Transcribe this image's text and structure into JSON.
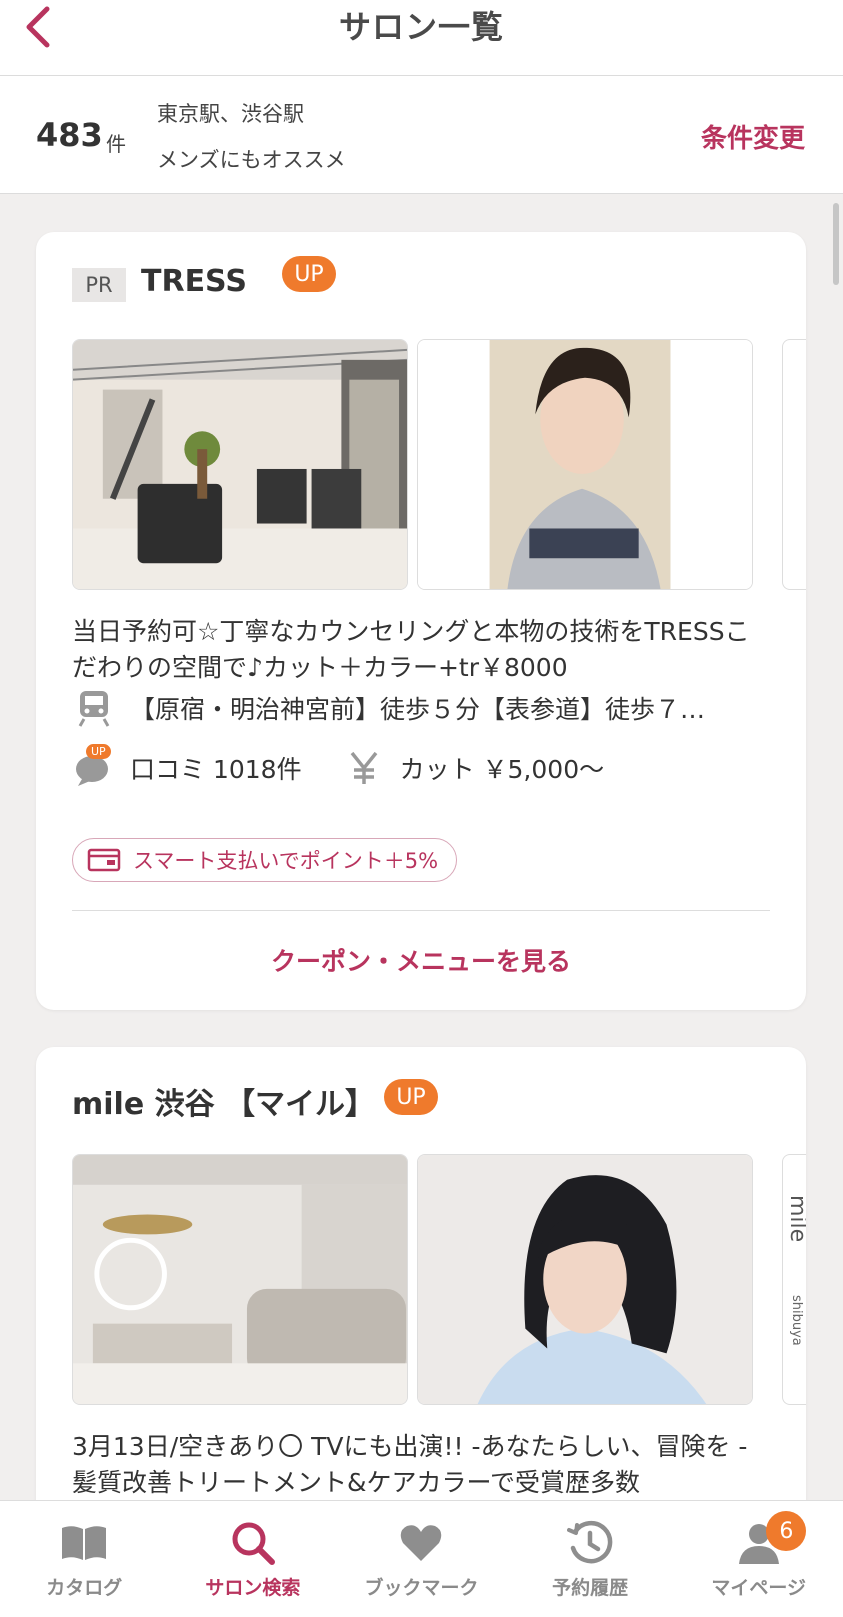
{
  "header": {
    "title": "サロン一覧"
  },
  "summary": {
    "count": "483",
    "count_unit": "件",
    "conditions": [
      "東京駅、渋谷駅",
      "メンズにもオススメ"
    ],
    "change_label": "条件変更"
  },
  "salons": [
    {
      "pr_label": "PR",
      "name": "TRESS",
      "badge": "UP",
      "description": "当日予約可☆丁寧なカウンセリングと本物の技術をTRESSこだわりの空間で♪カット＋カラー+tr￥8000",
      "access": "【原宿・明治神宮前】徒歩５分【表参道】徒歩７…",
      "review_badge": "UP",
      "reviews": "口コミ 1018件",
      "price": "カット ￥5,000〜",
      "payment": "スマート支払いでポイント＋5%",
      "coupon_label": "クーポン・メニューを見る"
    },
    {
      "name": "mile 渋谷 【マイル】",
      "badge": "UP",
      "peek_text": "mile",
      "peek_sub": "shibuya",
      "description": "3月13日/空きあり〇 TVにも出演!! -あなたらしい、冒険を -髪質改善トリートメント&ケアカラーで受賞歴多数"
    }
  ],
  "tabs": [
    {
      "label": "カタログ",
      "icon": "book-icon"
    },
    {
      "label": "サロン検索",
      "icon": "search-icon",
      "active": true
    },
    {
      "label": "ブックマーク",
      "icon": "heart-icon"
    },
    {
      "label": "予約履歴",
      "icon": "history-icon"
    },
    {
      "label": "マイページ",
      "icon": "person-icon",
      "badge": "6"
    }
  ],
  "colors": {
    "accent": "#b8345e",
    "up_badge": "#ef7a2c",
    "background": "#f1efee"
  }
}
